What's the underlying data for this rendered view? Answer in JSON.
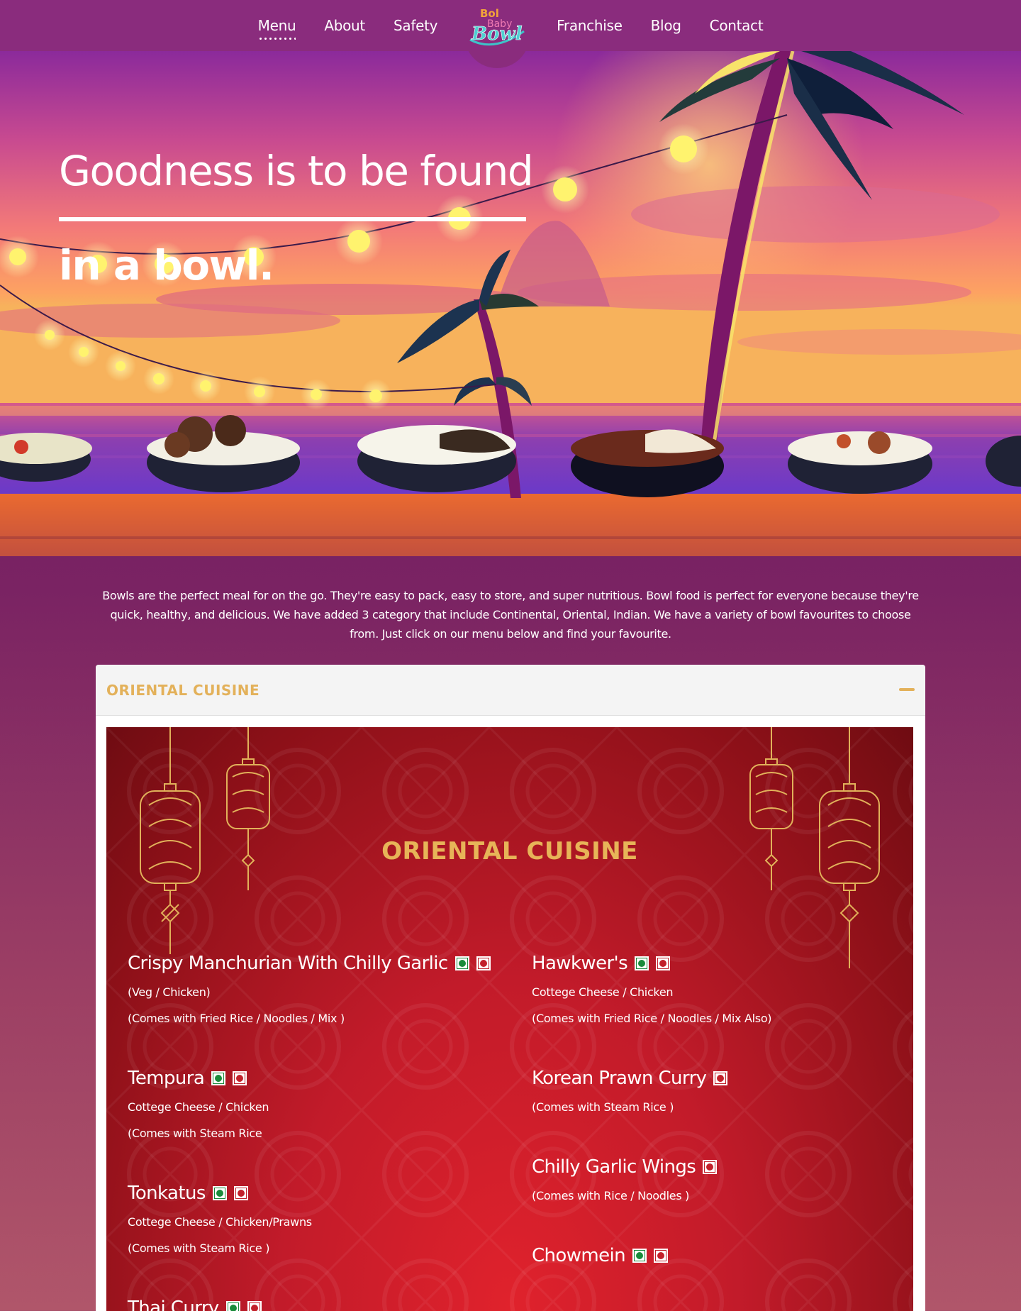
{
  "nav": {
    "items_left": [
      "Menu",
      "About",
      "Safety"
    ],
    "items_right": [
      "Franchise",
      "Blog",
      "Contact"
    ],
    "active": "Menu",
    "logo": {
      "line1": "Bol",
      "line2": "Baby",
      "line3": "Bowl"
    }
  },
  "hero": {
    "title_line1": "Goodness is to be found",
    "title_line2": "in a bowl."
  },
  "intro": "Bowls are the perfect meal for on the go. They're easy to pack, easy to store, and super nutritious. Bowl food is perfect for everyone because they're quick, healthy, and delicious. We have added 3 category that include Continental, Oriental, Indian. We have a variety of bowl favourites to choose from. Just click on our menu below and find your favourite.",
  "accordion": {
    "title": "ORIENTAL CUISINE",
    "panel_title": "ORIENTAL CUISINE"
  },
  "dishes": {
    "left": [
      {
        "name": "Crispy Manchurian With Chilly Garlic",
        "sub1": "(Veg / Chicken)",
        "sub2": "(Comes with Fried Rice / Noodles / Mix )",
        "marks": [
          "veg",
          "nonveg"
        ]
      },
      {
        "name": "Tempura",
        "sub1": "Cottege Cheese / Chicken",
        "sub2": "(Comes with Steam Rice",
        "marks": [
          "veg",
          "nonveg"
        ]
      },
      {
        "name": "Tonkatus",
        "sub1": "Cottege Cheese / Chicken/Prawns",
        "sub2": "(Comes with Steam Rice )",
        "marks": [
          "veg",
          "nonveg"
        ]
      },
      {
        "name": "Thai Curry",
        "sub1": "",
        "sub2": "",
        "marks": [
          "veg",
          "nonveg"
        ]
      }
    ],
    "right": [
      {
        "name": "Hawkwer's",
        "sub1": "Cottege Cheese / Chicken",
        "sub2": "(Comes with Fried Rice / Noodles / Mix Also)",
        "marks": [
          "veg",
          "nonveg"
        ]
      },
      {
        "name": "Korean Prawn Curry",
        "sub1": "(Comes with Steam Rice )",
        "sub2": "",
        "marks": [
          "nonveg"
        ]
      },
      {
        "name": "Chilly Garlic Wings",
        "sub1": "(Comes with Rice / Noodles )",
        "sub2": "",
        "marks": [
          "nonveg"
        ]
      },
      {
        "name": "Chowmein",
        "sub1": "",
        "sub2": "",
        "marks": [
          "veg",
          "nonveg"
        ]
      }
    ]
  },
  "colors": {
    "nav_bg": "#8a2c7d",
    "page_bg": "#641764",
    "accent_gold": "#e3b15a",
    "panel_red": "#c21b2a",
    "veg": "#1a8a3a",
    "nonveg": "#c2202a"
  }
}
